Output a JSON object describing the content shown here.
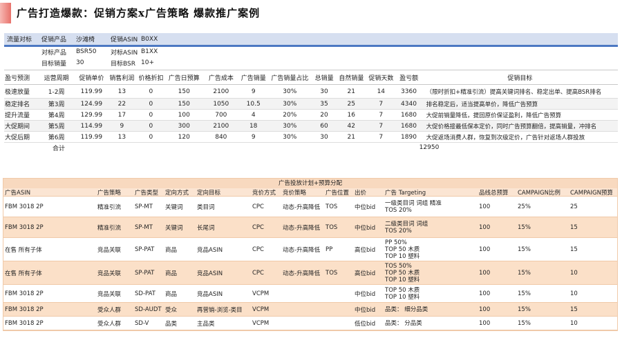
{
  "title": "广告打造爆款：促销方案x广告策略 爆款推广案例",
  "info": {
    "row1": [
      "流量对标",
      "促销产品",
      "沙滩椅",
      "促销ASIN",
      "B0XX"
    ],
    "row2": [
      "对标产品",
      "BSR50",
      "对标ASIN",
      "B1XX"
    ],
    "row3": [
      "目标销量",
      "30",
      "目标BSR",
      "10+"
    ]
  },
  "plan": {
    "headers": [
      "盈亏预测",
      "运营周期",
      "促销单价",
      "销售利润",
      "价格折扣",
      "广告日预算",
      "广告成本",
      "广告销量",
      "广告销量占比",
      "总销量",
      "自然销量",
      "促销天数",
      "盈亏额",
      "促销目标"
    ],
    "rows": [
      [
        "极速放量",
        "1-2周",
        "119.99",
        "13",
        "0",
        "150",
        "2100",
        "9",
        "30%",
        "30",
        "21",
        "14",
        "3360",
        "（限时折扣+精准引流）提高关键词排名、稳定出单、提高BSR排名"
      ],
      [
        "稳定排名",
        "第3周",
        "124.99",
        "22",
        "0",
        "150",
        "1050",
        "10.5",
        "30%",
        "35",
        "25",
        "7",
        "4340",
        "排名稳定后，适当提高单价，降低广告预算"
      ],
      [
        "提升流量",
        "第4周",
        "129.99",
        "17",
        "0",
        "100",
        "700",
        "4",
        "20%",
        "20",
        "16",
        "7",
        "1680",
        "大促前销量降低，提回原价保证盈利，降低广告预算"
      ],
      [
        "大促期间",
        "第5周",
        "114.99",
        "9",
        "0",
        "300",
        "2100",
        "18",
        "30%",
        "60",
        "42",
        "7",
        "1680",
        "大促价格接最低保本定价，同时广告预算翻倍，提高销量，冲排名"
      ],
      [
        "大促后期",
        "第6周",
        "119.99",
        "13",
        "0",
        "120",
        "840",
        "9",
        "30%",
        "30",
        "21",
        "7",
        "1890",
        "大促返场消费人群，恢复到次级定价，广告针对返场人群投放"
      ]
    ],
    "total_label": "合计",
    "total_value": "12950"
  },
  "ads": {
    "title": "广告投放计划+预算分配",
    "headers": [
      "广告ASIN",
      "广告策略",
      "广告类型",
      "定向方式",
      "定向目标",
      "竞价方式",
      "竞价策略",
      "广告位置",
      "出价",
      "广告 Targeting",
      "品线总预算",
      "CAMPAIGN比例",
      "CAMPAIGN预算"
    ],
    "rows": [
      {
        "cells": [
          "FBM 3018 2P",
          "精准引流",
          "SP-MT",
          "关键词",
          "类目词",
          "CPC",
          "动态-升高降低",
          "TOS",
          "中位bid"
        ],
        "targeting": [
          "一级类目词 词组  精准",
          "TOS 20%"
        ],
        "budget": [
          "100",
          "25%",
          "25"
        ]
      },
      {
        "cells": [
          "FBM 3018 2P",
          "精准引流",
          "SP-MT",
          "关键词",
          "长尾词",
          "CPC",
          "动态-升高降低",
          "TOS",
          "中位bid"
        ],
        "targeting": [
          "二级类目词 词组",
          "TOS 20%"
        ],
        "budget": [
          "100",
          "15%",
          "15"
        ]
      },
      {
        "cells": [
          "在售 所有子体",
          "竞品关联",
          "SP-PAT",
          "商品",
          "竞品ASIN",
          "CPC",
          "动态-升高降低",
          "PP",
          "高位bid"
        ],
        "targeting": [
          "PP 50%",
          "TOP 50 木质",
          "TOP 10 塑料"
        ],
        "budget": [
          "100",
          "15%",
          "15"
        ]
      },
      {
        "cells": [
          "在售 所有子体",
          "竞品关联",
          "SP-PAT",
          "商品",
          "竞品ASIN",
          "CPC",
          "动态-升高降低",
          "TOS",
          "高位bid"
        ],
        "targeting": [
          "TOS 50%",
          "TOP 50 木质",
          "TOP 10 塑料"
        ],
        "budget": [
          "100",
          "15%",
          "10"
        ]
      },
      {
        "cells": [
          "FBM 3018 2P",
          "竞品关联",
          "SD-PAT",
          "商品",
          "竞品ASIN",
          "VCPM",
          "",
          "",
          "中位bid"
        ],
        "targeting": [
          "TOP 50 木质",
          "TOP 10 塑料"
        ],
        "budget": [
          "100",
          "15%",
          "10"
        ]
      },
      {
        "cells": [
          "FBM 3018 2P",
          "受众人群",
          "SD-AUDT",
          "受众",
          "再营销-浏览-类目",
          "VCPM",
          "",
          "",
          "中位bid"
        ],
        "targeting": [
          "品类：  细分品类"
        ],
        "budget": [
          "100",
          "15%",
          "15"
        ]
      },
      {
        "cells": [
          "FBM 3018 2P",
          "受众人群",
          "SD-V",
          "品类",
          "主品类",
          "VCPM",
          "",
          "",
          "低位bid"
        ],
        "targeting": [
          "品类：  分品类"
        ],
        "budget": [
          "100",
          "15%",
          "10"
        ]
      }
    ]
  }
}
